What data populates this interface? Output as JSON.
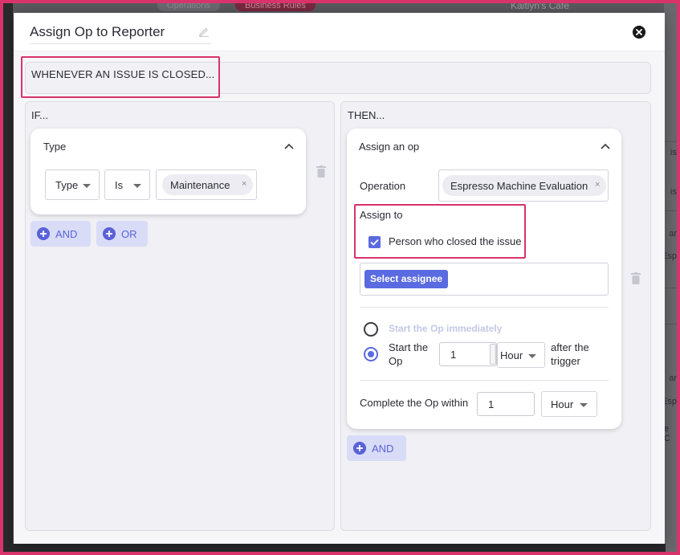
{
  "background": {
    "tab_operations": "Operations",
    "tab_business_rules": "Business Rules",
    "location": "Kaitlyn's Cafe",
    "right_fragments": [
      "is",
      "is",
      "ar",
      "Esp",
      "ar",
      "Esp",
      "e C"
    ]
  },
  "modal": {
    "title": "Assign Op to Reporter",
    "trigger": "WHENEVER AN ISSUE IS CLOSED..."
  },
  "if_panel": {
    "heading": "IF...",
    "card_title": "Type",
    "condition": {
      "field": "Type",
      "operator": "Is",
      "value": "Maintenance"
    },
    "and_label": "AND",
    "or_label": "OR"
  },
  "then_panel": {
    "heading": "THEN...",
    "card_title": "Assign an op",
    "operation_label": "Operation",
    "operation_value": "Espresso Machine Evaluation",
    "assign_to_label": "Assign to",
    "checkbox_label": "Person who closed the issue",
    "select_assignee": "Select assignee",
    "start_immediately": "Start the Op immediately",
    "start_the_op_line1": "Start the",
    "start_the_op_line2": "Op",
    "start_value": "1",
    "start_unit": "Hour",
    "after_trigger_line1": "after the",
    "after_trigger_line2": "trigger",
    "complete_label": "Complete the Op within",
    "complete_value": "1",
    "complete_unit": "Hour",
    "and_label": "AND"
  },
  "colors": {
    "accent": "#5a6ae0",
    "highlight": "#d8336a",
    "panel_bg": "#f0f0f5"
  }
}
